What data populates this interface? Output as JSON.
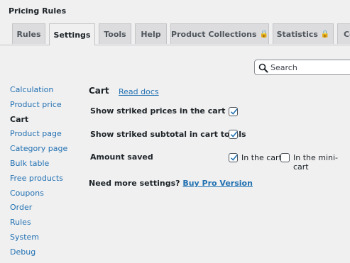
{
  "page": {
    "title": "Pricing Rules"
  },
  "tabs": [
    {
      "label": "Rules",
      "locked": false,
      "active": false
    },
    {
      "label": "Settings",
      "locked": false,
      "active": true
    },
    {
      "label": "Tools",
      "locked": false,
      "active": false
    },
    {
      "label": "Help",
      "locked": false,
      "active": false
    },
    {
      "label": "Product Collections",
      "locked": true,
      "active": false
    },
    {
      "label": "Statistics",
      "locked": true,
      "active": false
    },
    {
      "label": "Co",
      "locked": false,
      "active": false
    }
  ],
  "search": {
    "placeholder": "Search",
    "value": ""
  },
  "sidebar": {
    "items": [
      {
        "label": "Calculation",
        "current": false
      },
      {
        "label": "Product price",
        "current": false
      },
      {
        "label": "Cart",
        "current": true
      },
      {
        "label": "Product page",
        "current": false
      },
      {
        "label": "Category page",
        "current": false
      },
      {
        "label": "Bulk table",
        "current": false
      },
      {
        "label": "Free products",
        "current": false
      },
      {
        "label": "Coupons",
        "current": false
      },
      {
        "label": "Order",
        "current": false
      },
      {
        "label": "Rules",
        "current": false
      },
      {
        "label": "System",
        "current": false
      },
      {
        "label": "Debug",
        "current": false
      }
    ]
  },
  "section": {
    "title": "Cart",
    "docs_link": "Read docs"
  },
  "settings": {
    "striked_prices": {
      "label": "Show striked prices in the cart",
      "checked": true
    },
    "striked_subtotal": {
      "label": "Show striked subtotal in cart totals",
      "checked": true
    },
    "amount_saved": {
      "label": "Amount saved",
      "options": [
        {
          "label": "In the cart",
          "checked": true
        },
        {
          "label": "In the mini-cart",
          "checked": false
        }
      ]
    }
  },
  "promo": {
    "text": "Need more settings?",
    "link": "Buy Pro Version"
  },
  "colors": {
    "link": "#2271b1",
    "check": "#2271b1",
    "background": "#f0f0f1"
  },
  "icons": {
    "search": "search-icon",
    "lock": "lock-icon",
    "check": "checkmark-icon"
  }
}
